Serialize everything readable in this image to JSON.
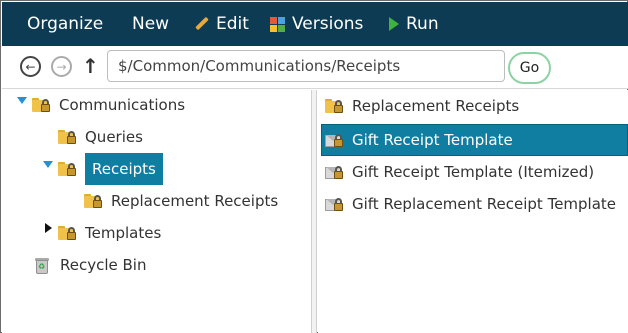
{
  "toolbar": {
    "organize": "Organize",
    "new": "New",
    "edit": "Edit",
    "versions": "Versions",
    "run": "Run",
    "icons": {
      "edit": "pencil-icon",
      "versions": "versions-grid-icon",
      "run": "play-icon"
    },
    "background_color": "#0c3b53"
  },
  "navbar": {
    "back_icon": "back-arrow-icon",
    "forward_icon": "forward-arrow-icon",
    "up_icon": "up-arrow-icon",
    "path": "$/Common/Communications/Receipts",
    "go_label": "Go"
  },
  "tree": {
    "root": "Communications",
    "queries": "Queries",
    "receipts": "Receipts",
    "replacement_receipts": "Replacement Receipts",
    "templates": "Templates",
    "recycle_bin": "Recycle Bin",
    "selected_item": "Receipts"
  },
  "list": {
    "items": [
      {
        "label": "Replacement Receipts",
        "icon": "locked-folder-icon"
      },
      {
        "label": "Gift Receipt Template",
        "icon": "locked-envelope-icon",
        "selected": true
      },
      {
        "label": "Gift Receipt Template (Itemized)",
        "icon": "locked-envelope-icon"
      },
      {
        "label": "Gift Replacement Receipt Template",
        "icon": "locked-envelope-icon"
      }
    ]
  },
  "colors": {
    "selection": "#0f7ea1",
    "go_border": "#8cd3a4",
    "expand_toggle": "#2a8fd3"
  }
}
